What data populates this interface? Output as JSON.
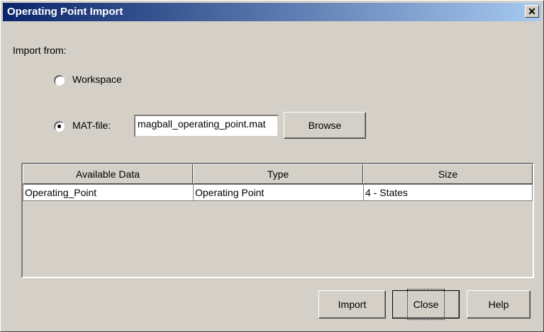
{
  "window": {
    "title": "Operating Point Import",
    "close_glyph": "✕"
  },
  "import_from": {
    "label": "Import from:"
  },
  "workspace": {
    "label": "Workspace",
    "selected": false
  },
  "matfile": {
    "label": "MAT-file:",
    "selected": true,
    "value": "magball_operating_point.mat"
  },
  "browse_button": "Browse",
  "table": {
    "headers": [
      "Available Data",
      "Type",
      "Size"
    ],
    "rows": [
      [
        "Operating_Point",
        "Operating Point",
        "4 - States"
      ]
    ]
  },
  "buttons": {
    "import": "Import",
    "close": "Close",
    "help": "Help"
  }
}
